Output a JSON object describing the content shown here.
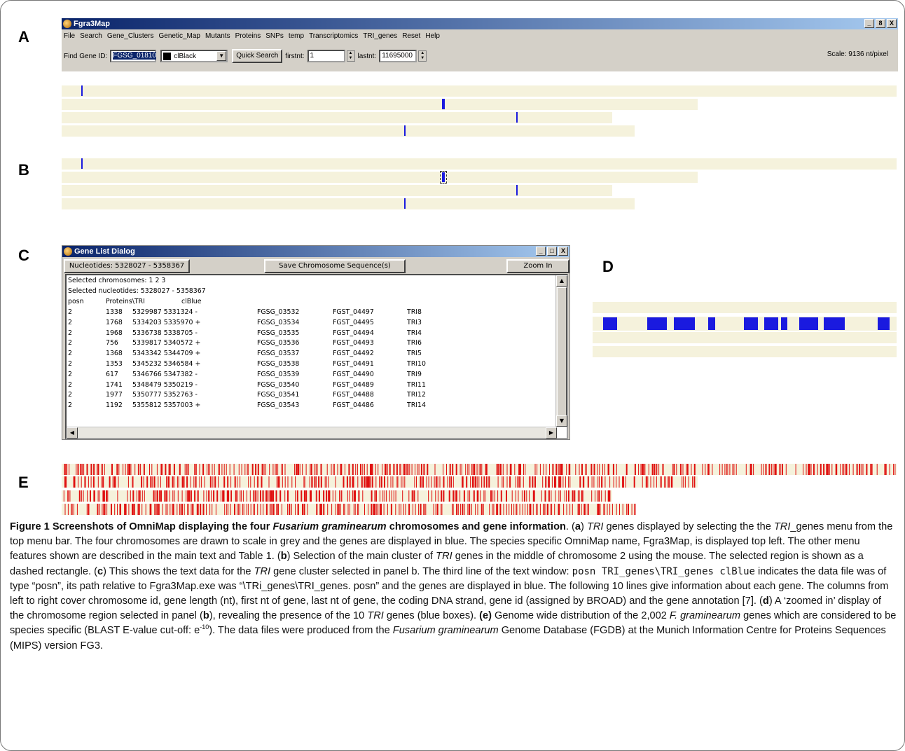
{
  "panel_labels": {
    "a": "A",
    "b": "B",
    "c": "C",
    "d": "D",
    "e": "E"
  },
  "app": {
    "title": "Fgra3Map",
    "menu": [
      "File",
      "Search",
      "Gene_Clusters",
      "Genetic_Map",
      "Mutants",
      "Proteins",
      "SNPs",
      "temp",
      "Transcriptomics",
      "TRI_genes",
      "Reset",
      "Help"
    ],
    "find_label": "Find Gene ID:",
    "find_value": "FGSG_01810",
    "color_value": "clBlack",
    "quick_search": "Quick Search",
    "firstnt_label": "firstnt:",
    "firstnt_value": "1",
    "lastnt_label": "lastnt:",
    "lastnt_value": "11695000",
    "scale": "Scale: 9136 nt/pixel",
    "win_min": "_",
    "win_max": "8",
    "win_close": "X"
  },
  "dialog": {
    "title": "Gene List Dialog",
    "nucleotides": "Nucleotides: 5328027 - 5358367",
    "save_button": "Save Chromosome Sequence(s)",
    "zoom_button": "Zoom In",
    "line1": "Selected chromosomes:  1 2 3",
    "line2": "Selected nucleotides: 5328027 - 5358367",
    "header": [
      "posn",
      "Proteins\\TRI",
      "clBlue"
    ],
    "rows": [
      [
        "2",
        "1338",
        "5329987 5331324  -",
        "FGSG_03532",
        "FGST_04497",
        "TRI8"
      ],
      [
        "2",
        "1768",
        "5334203 5335970  +",
        "FGSG_03534",
        "FGST_04495",
        "TRI3"
      ],
      [
        "2",
        "1968",
        "5336738 5338705  -",
        "FGSG_03535",
        "FGST_04494",
        "TRI4"
      ],
      [
        "2",
        "756",
        "5339817 5340572  +",
        "FGSG_03536",
        "FGST_04493",
        "TRI6"
      ],
      [
        "2",
        "1368",
        "5343342 5344709  +",
        "FGSG_03537",
        "FGST_04492",
        "TRI5"
      ],
      [
        "2",
        "1353",
        "5345232 5346584  +",
        "FGSG_03538",
        "FGST_04491",
        "TRI10"
      ],
      [
        "2",
        "617",
        "5346766 5347382  -",
        "FGSG_03539",
        "FGST_04490",
        "TRI9"
      ],
      [
        "2",
        "1741",
        "5348479 5350219  -",
        "FGSG_03540",
        "FGST_04489",
        "TRI11"
      ],
      [
        "2",
        "1977",
        "5350777 5352763  -",
        "FGSG_03541",
        "FGST_04488",
        "TRI12"
      ],
      [
        "2",
        "1192",
        "5355812 5357003  +",
        "FGSG_03543",
        "FGST_04486",
        "TRI14"
      ]
    ]
  },
  "colors": {
    "chromosome": "#f5f2dc",
    "gene": "#1a1adf",
    "species_specific": "#e01010",
    "titlebar": "#0a246a"
  },
  "caption": {
    "fig": "Figure 1 Screenshots of OmniMap displaying the four",
    "fig_species": "Fusarium graminearum",
    "fig_end": "chromosomes and gene information",
    "a_lbl": "a",
    "tri": "TRI",
    "t1": "genes displayed by selecting the",
    "tri2": "TRI",
    "t2": "_genes menu from the top menu bar. The four chromosomes are drawn to scale in grey and the genes are displayed in blue. The species specific OmniMap name, Fgra3Map, is displayed top left. The other menu features shown are described in the main text and Table 1. (",
    "b_lbl": "b",
    "t3": ") Selection of the main cluster of",
    "tri3": "TRI",
    "t4": "genes in the middle of chromosome 2 using the mouse. The selected region is shown as a dashed rectangle. (",
    "c_lbl": "c",
    "t5": ") This shows the text data for the",
    "tri4": "TRI",
    "t6": "gene cluster selected in panel b. The third line of the text window:",
    "code": "posn TRI_genes\\TRI_genes clBlue",
    "t7": "indicates the data file was of type “posn”, its path relative to Fgra3Map.exe was “\\TRi_genes\\TRI_genes. posn” and the genes are displayed in blue. The following 10 lines give information about each gene. The columns from left to right cover chromosome id, gene length (nt), first nt of gene, last nt of gene, the coding DNA strand, gene id (assigned by BROAD) and the gene annotation [7]. (",
    "d_lbl": "d",
    "t8": ") A ‘zoomed in’ display of the chromosome region selected in panel (",
    "b_lbl2": "b",
    "t9": "), revealing the presence of the 10",
    "tri5": "TRI",
    "t10": "genes (blue boxes).",
    "e_lbl": "(e)",
    "t11": "Genome wide distribution of the 2,002",
    "species2": "F. graminearum",
    "t12": "genes which are considered to be species specific (BLAST E-value cut-off: e",
    "sup": "-10",
    "t13": "). The data files were produced from the",
    "species3": "Fusarium graminearum",
    "t14": "Genome Database (FGDB) at the Munich Information Centre for Proteins Sequences (MIPS) version FG3."
  }
}
